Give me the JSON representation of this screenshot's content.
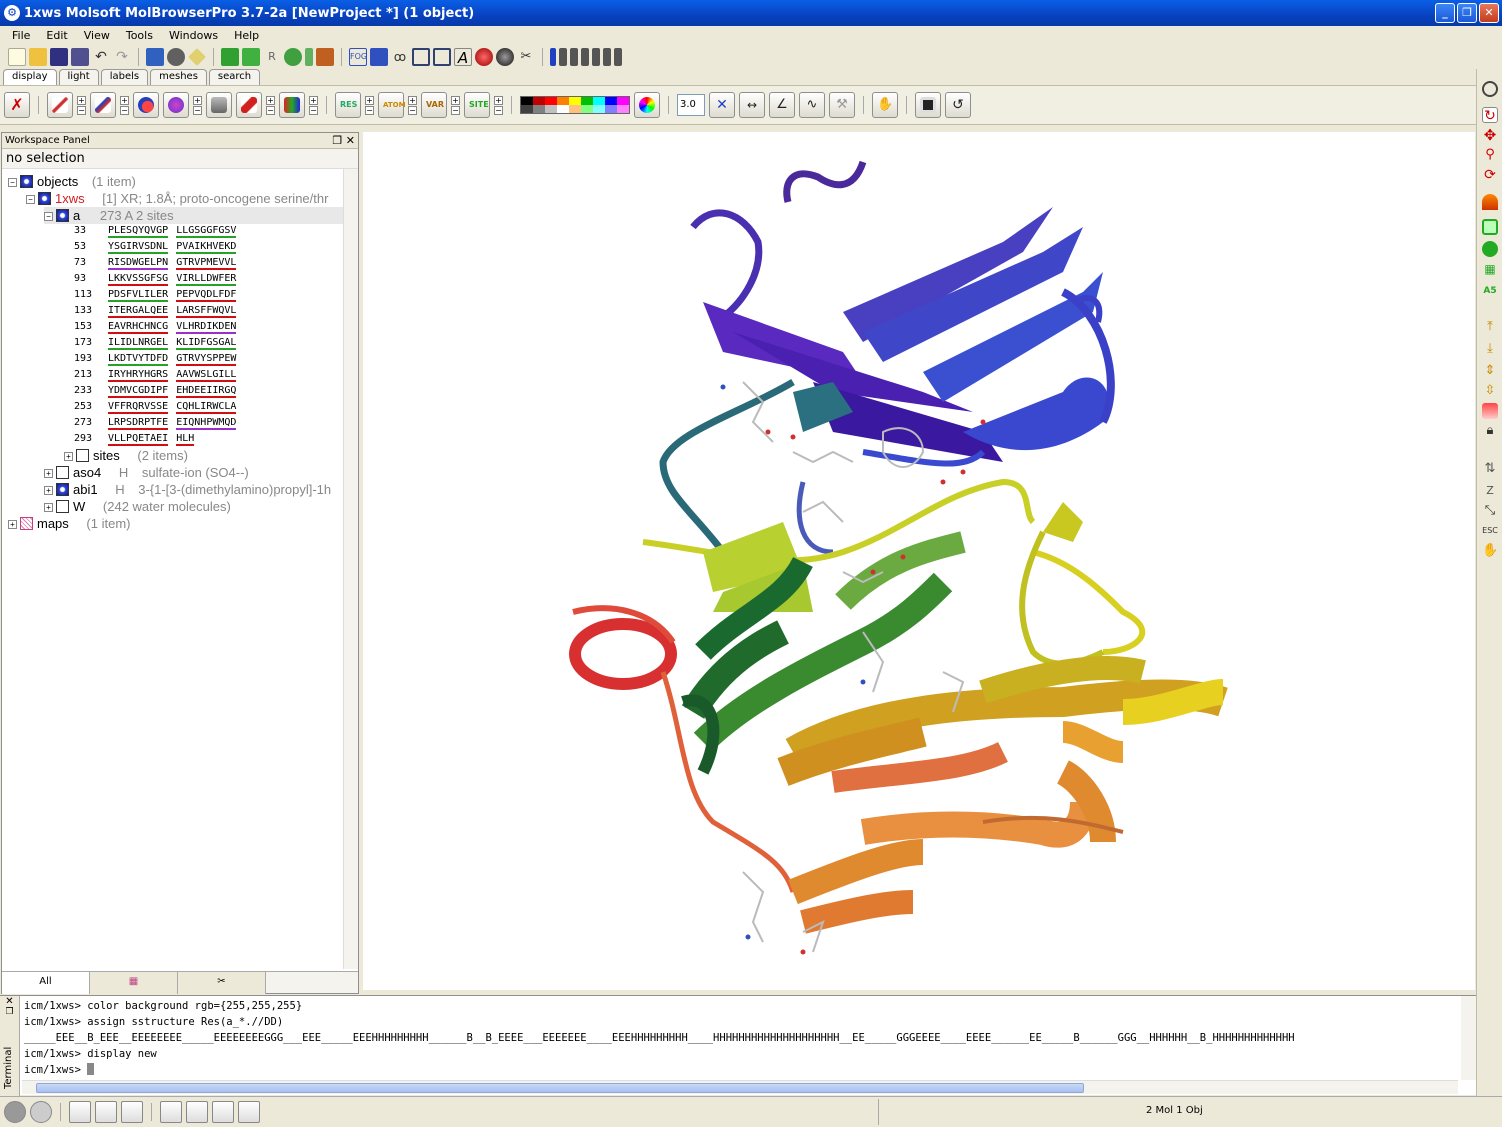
{
  "window": {
    "title": "1xws Molsoft MolBrowserPro 3.7-2a  [NewProject *] (1 object)",
    "buttons": [
      "_",
      "❐",
      "✕"
    ]
  },
  "menu": [
    "File",
    "Edit",
    "View",
    "Tools",
    "Windows",
    "Help"
  ],
  "tabs": [
    "display",
    "light",
    "labels",
    "meshes",
    "search"
  ],
  "toolbar": {
    "zoom_value": "3.0",
    "palette_colors": [
      "#000000",
      "#c00000",
      "#ff0000",
      "#ff8000",
      "#ffff00",
      "#00c000",
      "#00ffff",
      "#0000ff",
      "#ff00ff",
      "#404040",
      "#808080",
      "#c0c0c0",
      "#ffffff",
      "#ffc080",
      "#80ff80",
      "#80ffff",
      "#8080ff",
      "#ff80ff"
    ]
  },
  "workspace": {
    "panel_title": "Workspace Panel",
    "selection": "no selection",
    "objects_label": "objects",
    "objects_count": "(1 item)",
    "object_name": "1xws",
    "object_desc": "[1] XR; 1.8Å; proto-oncogene serine/thr",
    "chain_name": "a",
    "chain_desc": "273 A  2 sites",
    "sequences": [
      {
        "num": "33",
        "a": "PLESQYQVGP",
        "b": "LLGSGGFGSV",
        "ca": "#2aa02a",
        "cb": "#2aa02a"
      },
      {
        "num": "53",
        "a": "YSGIRVSDNL",
        "b": "PVAIKHVEKD",
        "ca": "#2aa02a",
        "cb": "#2aa02a"
      },
      {
        "num": "73",
        "a": "RISDWGELPN",
        "b": "GTRVPMEVVL",
        "ca": "#9b30c8",
        "cb": "#d01010"
      },
      {
        "num": "93",
        "a": "LKKVSSGFSG",
        "b": "VIRLLDWFER",
        "ca": "#d01010",
        "cb": "#2aa02a"
      },
      {
        "num": "113",
        "a": "PDSFVLILER",
        "b": "PEPVQDLFDF",
        "ca": "#2aa02a",
        "cb": "#d01010"
      },
      {
        "num": "133",
        "a": "ITERGALQEE",
        "b": "LARSFFWQVL",
        "ca": "#d01010",
        "cb": "#d01010"
      },
      {
        "num": "153",
        "a": "EAVRHCHNCG",
        "b": "VLHRDIKDEN",
        "ca": "#d01010",
        "cb": "#9b30c8"
      },
      {
        "num": "173",
        "a": "ILIDLNRGEL",
        "b": "KLIDFGSGAL",
        "ca": "#2aa02a",
        "cb": "#2aa02a"
      },
      {
        "num": "193",
        "a": "LKDTVYTDFD",
        "b": "GTRVYSPPEW",
        "ca": "#2aa02a",
        "cb": "#d01010"
      },
      {
        "num": "213",
        "a": "IRYHRYHGRS",
        "b": "AAVWSLGILL",
        "ca": "#d01010",
        "cb": "#d01010"
      },
      {
        "num": "233",
        "a": "YDMVCGDIPF",
        "b": "EHDEEIIRGQ",
        "ca": "#d01010",
        "cb": "#d01010"
      },
      {
        "num": "253",
        "a": "VFFRQRVSSE",
        "b": "CQHLIRWCLA",
        "ca": "#d01010",
        "cb": "#d01010"
      },
      {
        "num": "273",
        "a": "LRPSDRPTFE",
        "b": "EIQNHPWMQD",
        "ca": "#d01010",
        "cb": "#9b30c8"
      },
      {
        "num": "293",
        "a": "VLLPQETAEI",
        "b": "HLH",
        "ca": "#d01010",
        "cb": "#d01010"
      }
    ],
    "sites_label": "sites",
    "sites_count": "(2 items)",
    "aso4_name": "aso4",
    "aso4_type": "H",
    "aso4_desc": "sulfate-ion (SO4--)",
    "abi1_name": "abi1",
    "abi1_type": "H",
    "abi1_desc": "3-{1-[3-(dimethylamino)propyl]-1h",
    "w_name": "W",
    "w_desc": "(242 water molecules)",
    "maps_label": "maps",
    "maps_count": "(1 item)",
    "bottom_tabs": [
      "All",
      "",
      ""
    ]
  },
  "console": {
    "label": "Terminal",
    "lines": [
      "icm/1xws> color background rgb={255,255,255}",
      "icm/1xws> assign sstructure Res(a_*.//DD)",
      "_____EEE__B_EEE__EEEEEEEE_____EEEEEEEEGGG___EEE_____EEEHHHHHHHHH______B__B_EEEE___EEEEEEE____EEEHHHHHHHHH____HHHHHHHHHHHHHHHHHHHH__EE_____GGGEEEE____EEEE______EE_____B______GGG__HHHHHH__B_HHHHHHHHHHHHH",
      "icm/1xws> display new",
      "icm/1xws> "
    ]
  },
  "status": {
    "text": "2 Mol 1 Obj"
  }
}
